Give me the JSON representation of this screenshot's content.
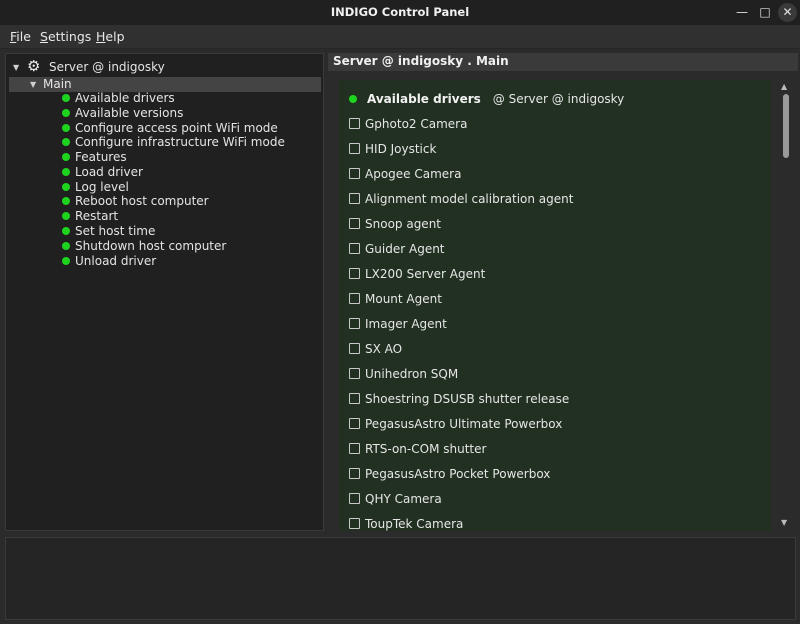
{
  "window": {
    "title": "INDIGO Control Panel",
    "minimize": "—",
    "maximize": "□",
    "close": "✕"
  },
  "menu": [
    {
      "accel": "F",
      "rest": "ile"
    },
    {
      "accel": "S",
      "rest": "ettings"
    },
    {
      "accel": "H",
      "rest": "elp"
    }
  ],
  "tree": {
    "root_label": "Server @ indigosky",
    "main_label": "Main",
    "items": [
      "Available drivers",
      "Available versions",
      "Configure access point WiFi mode",
      "Configure infrastructure WiFi mode",
      "Features",
      "Load driver",
      "Log level",
      "Reboot host computer",
      "Restart",
      "Set host time",
      "Shutdown host computer",
      "Unload driver"
    ]
  },
  "panel": {
    "header": "Server @ indigosky . Main",
    "property_title": "Available drivers",
    "property_server": "@ Server @ indigosky",
    "drivers": [
      "Gphoto2 Camera",
      "HID Joystick",
      "Apogee Camera",
      "Alignment model calibration agent",
      "Snoop agent",
      "Guider Agent",
      "LX200 Server Agent",
      "Mount Agent",
      "Imager Agent",
      "SX AO",
      "Unihedron SQM",
      "Shoestring DSUSB shutter release",
      "PegasusAstro Ultimate Powerbox",
      "RTS-on-COM shutter",
      "PegasusAstro Pocket Powerbox",
      "QHY Camera",
      "ToupTek Camera"
    ]
  },
  "colors": {
    "status_ok": "#1ed31e",
    "property_bg": "#213021",
    "selection_bg": "#444444"
  },
  "icons": {
    "server": "gear-icon",
    "status": "green-dot-icon"
  }
}
